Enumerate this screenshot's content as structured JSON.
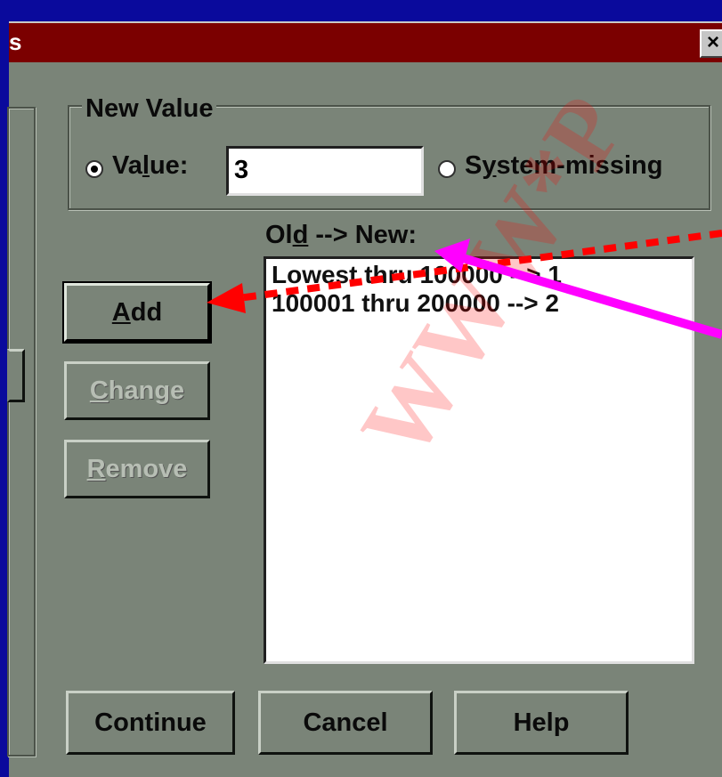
{
  "dialog": {
    "title_fragment": "s",
    "close_label": "×"
  },
  "new_value": {
    "group_label": "New Value",
    "value_radio_pre": "Va",
    "value_radio_ul": "l",
    "value_radio_post": "ue:",
    "value_input": "3",
    "sysmissing_pre": "S",
    "sysmissing_ul": "y",
    "sysmissing_post": "stem-missing",
    "selected_option": "value"
  },
  "old_new": {
    "label_pre": "Ol",
    "label_ul": "d",
    "label_post": " --> New:",
    "items": [
      "Lowest thru 100000 --> 1",
      "100001 thru 200000 --> 2"
    ]
  },
  "buttons": {
    "add_ul": "A",
    "add_rest": "dd",
    "change_ul": "C",
    "change_rest": "hange",
    "remove_ul": "R",
    "remove_rest": "emove",
    "continue": "Continue",
    "cancel": "Cancel",
    "help": "Help"
  },
  "annotations": {
    "dashed_arrow_color": "#ff0000",
    "solid_arrow_color": "#ff00ff"
  },
  "watermark": "WWW*P"
}
